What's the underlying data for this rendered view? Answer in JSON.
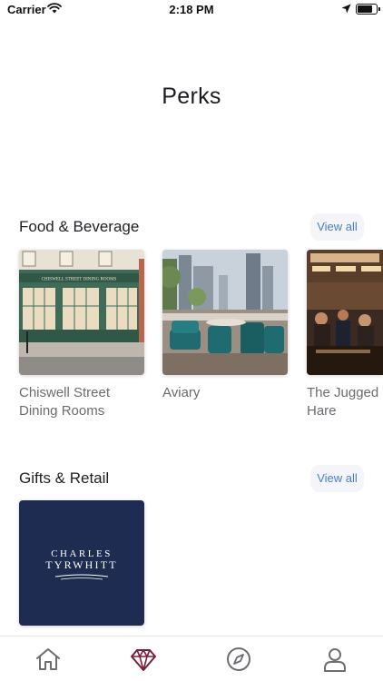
{
  "status_bar": {
    "carrier": "Carrier",
    "time": "2:18 PM",
    "battery_level": 0.85,
    "icons": [
      "wifi-icon",
      "location-arrow-icon",
      "battery-icon"
    ]
  },
  "page": {
    "title": "Perks"
  },
  "sections": [
    {
      "title": "Food & Beverage",
      "view_all_label": "View all",
      "items": [
        {
          "label": "Chiswell Street Dining Rooms",
          "sign_text": "CHISWELL STREET DINING ROOMS"
        },
        {
          "label": "Aviary"
        },
        {
          "label": "The Jugged Hare"
        }
      ]
    },
    {
      "title": "Gifts & Retail",
      "view_all_label": "View all",
      "items": [
        {
          "label": "",
          "logo_text_line1": "CHARLES",
          "logo_text_line2": "TYRWHITT"
        }
      ]
    }
  ],
  "tab_bar": {
    "tabs": [
      {
        "name": "home",
        "icon": "home-icon",
        "active": false
      },
      {
        "name": "perks",
        "icon": "diamond-icon",
        "active": true
      },
      {
        "name": "explore",
        "icon": "compass-icon",
        "active": false
      },
      {
        "name": "profile",
        "icon": "person-icon",
        "active": false
      }
    ]
  },
  "colors": {
    "accent_link": "#4a7ec9",
    "view_all_bg": "#f3f5f9",
    "active_tab": "#7a1e3a",
    "inactive_tab": "#6d6d72",
    "charles_tyrwhitt_navy": "#1d2c50"
  }
}
